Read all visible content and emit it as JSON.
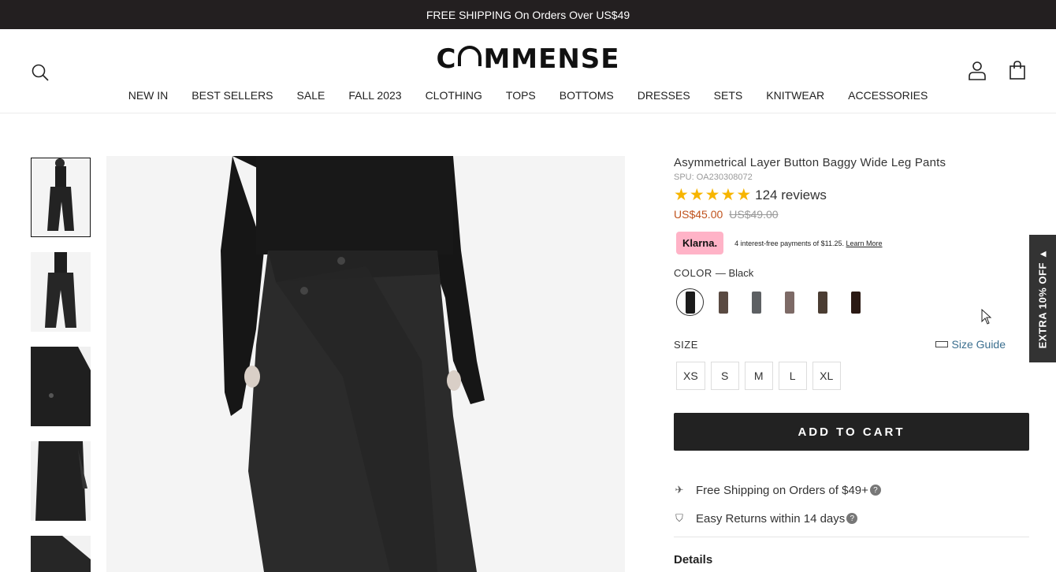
{
  "announcement": "FREE SHIPPING On Orders Over US$49",
  "brand": {
    "logo_before": "C",
    "logo_after": "MMENSE"
  },
  "nav": [
    "NEW IN",
    "BEST SELLERS",
    "SALE",
    "FALL 2023",
    "CLOTHING",
    "TOPS",
    "BOTTOMS",
    "DRESSES",
    "SETS",
    "KNITWEAR",
    "ACCESSORIES"
  ],
  "product": {
    "title": "Asymmetrical Layer Button Baggy Wide Leg Pants",
    "spu": "SPU: OA230308072",
    "rating": 5,
    "reviews": "124 reviews",
    "price_now": "US$45.00",
    "price_was": "US$49.00",
    "klarna_badge": "Klarna.",
    "klarna_text": "4 interest-free payments of $11.25.",
    "klarna_link": "Learn More",
    "color_label": "COLOR",
    "color_value": "— Black",
    "swatches": [
      {
        "name": "Black",
        "color": "#1c1c1c"
      },
      {
        "name": "Coffee",
        "color": "#5a4a42"
      },
      {
        "name": "Grey",
        "color": "#5d6063"
      },
      {
        "name": "Mauve",
        "color": "#7d6a66"
      },
      {
        "name": "Brown",
        "color": "#4b3d33"
      },
      {
        "name": "Dark Brown",
        "color": "#2b1a14"
      }
    ],
    "size_label": "SIZE",
    "size_guide": "Size Guide",
    "sizes": [
      "XS",
      "S",
      "M",
      "L",
      "XL"
    ],
    "add_to_cart": "ADD TO CART",
    "perks": [
      "Free Shipping on Orders of $49+",
      "Easy Returns within 14 days"
    ],
    "details": "Details"
  },
  "extra_tab": "EXTRA 10% OFF ▲"
}
